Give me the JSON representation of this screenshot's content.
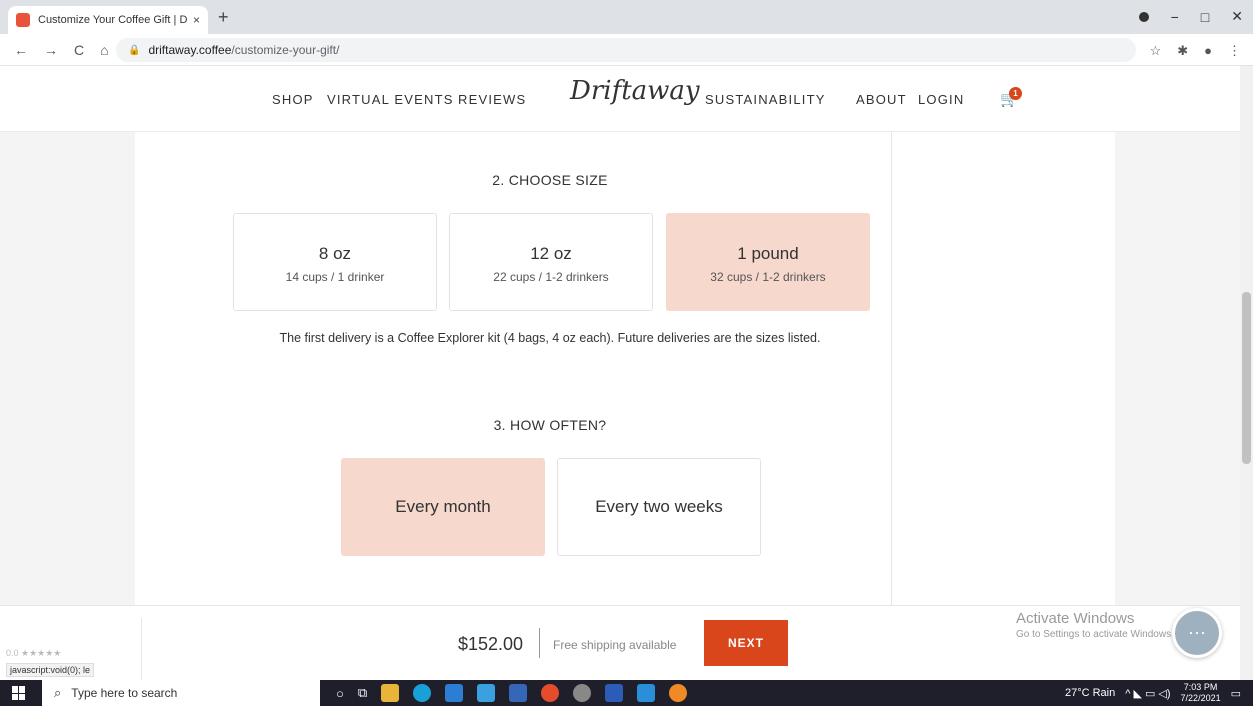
{
  "browser": {
    "tab_title": "Customize Your Coffee Gift | Drif",
    "tab_close": "×",
    "new_tab": "+",
    "nav_back": "←",
    "nav_forward": "→",
    "nav_reload": "C",
    "nav_home": "⌂",
    "url_host": "driftaway.coffee",
    "url_path": "/customize-your-gift/",
    "ext_star": "☆",
    "ext_puzzle": "✱",
    "ext_profile": "●",
    "ext_menu": "⋮",
    "win_min": "−",
    "win_max": "□",
    "win_close": "✕"
  },
  "site": {
    "nav_left": [
      "SHOP",
      "VIRTUAL EVENTS",
      "REVIEWS"
    ],
    "logo": "Driftaway",
    "nav_right": [
      "SUSTAINABILITY",
      "ABOUT",
      "LOGIN"
    ],
    "cart_count": "1"
  },
  "size_section": {
    "title": "2. CHOOSE SIZE",
    "options": [
      {
        "label": "8 oz",
        "detail": "14 cups / 1 drinker",
        "selected": false
      },
      {
        "label": "12 oz",
        "detail": "22 cups / 1-2 drinkers",
        "selected": false
      },
      {
        "label": "1 pound",
        "detail": "32 cups / 1-2 drinkers",
        "selected": true
      }
    ],
    "note": "The first delivery is a Coffee Explorer kit (4 bags, 4 oz each). Future deliveries are the sizes listed."
  },
  "frequency_section": {
    "title": "3. HOW OFTEN?",
    "options": [
      {
        "label": "Every month",
        "selected": true
      },
      {
        "label": "Every two weeks",
        "selected": false
      }
    ]
  },
  "footer": {
    "price": "$152.00",
    "shipping": "Free shipping available",
    "next_label": "NEXT",
    "rating_stars": "0.0 ★★★★★",
    "status_url": "javascript:void(0);",
    "status_trailing": "le",
    "activate_title": "Activate Windows",
    "activate_sub": "Go to Settings to activate Windows.",
    "chat_glyph": "···"
  },
  "taskbar": {
    "search_placeholder": "Type here to search",
    "weather": "27°C  Rain",
    "time": "7:03 PM",
    "date": "7/22/2021",
    "tray_icons": "^ ◣ ▭ ◁)"
  },
  "colors": {
    "accent": "#d9461b",
    "selected_bg": "#f6d8cd",
    "taskbar_bg": "#1f1f2b"
  }
}
